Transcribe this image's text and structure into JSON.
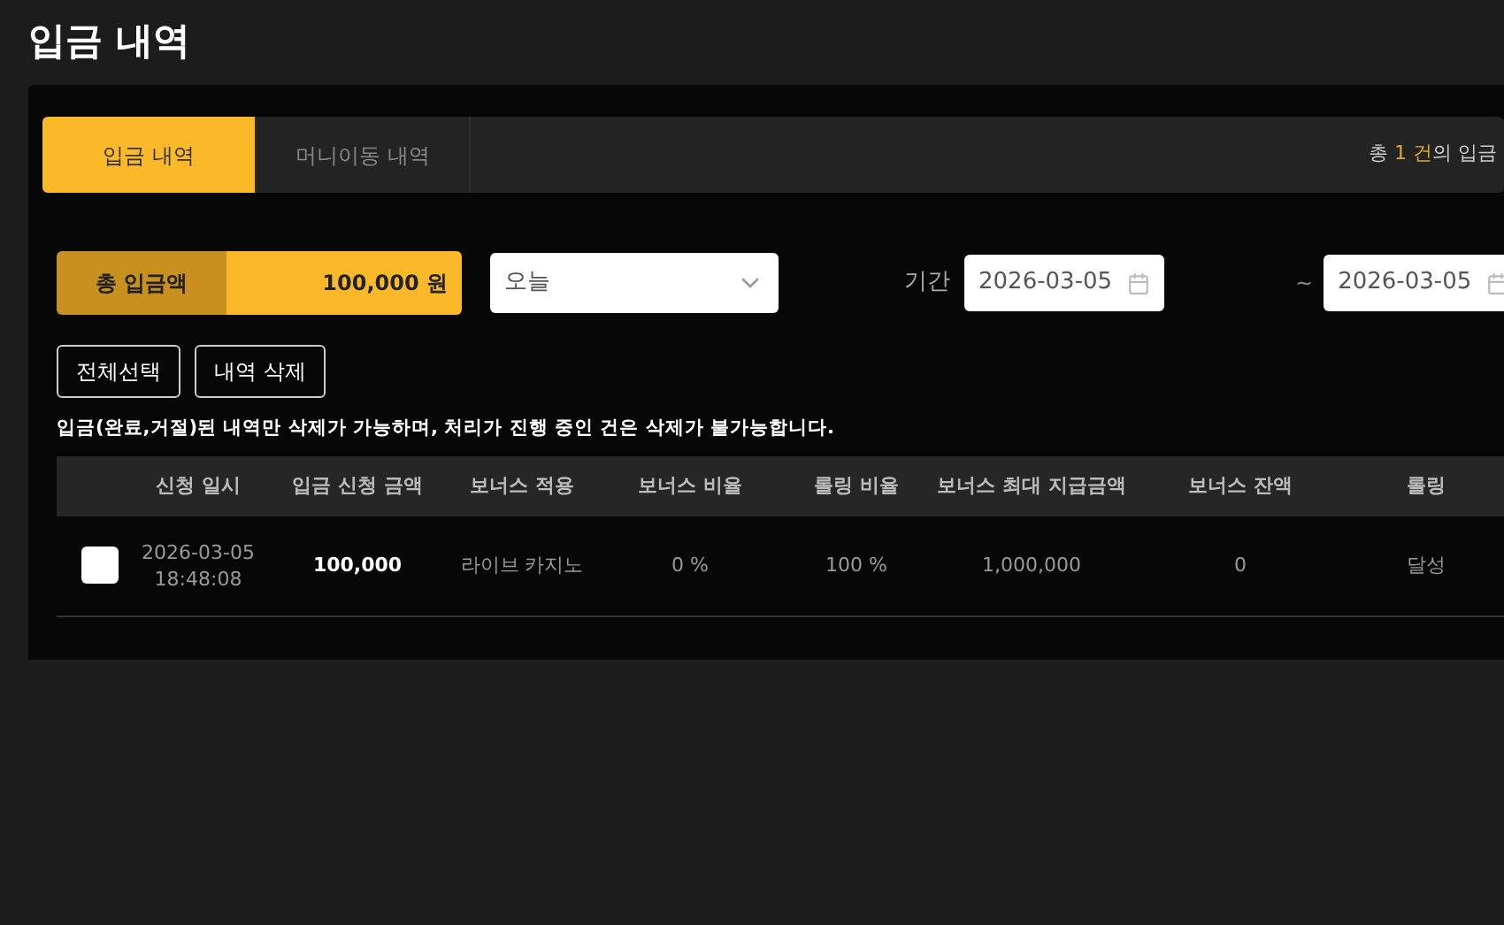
{
  "title": "입금 내역",
  "tabs": [
    {
      "label": "입금 내역",
      "selected": true
    },
    {
      "label": "머니이동 내역",
      "selected": false
    }
  ],
  "summary": {
    "prefix": "총",
    "count": "1 건",
    "suffix": "의 입금"
  },
  "total": {
    "label": "총 입금액",
    "value": "100,000 원"
  },
  "period_select": {
    "value": "오늘"
  },
  "period_label": "기간",
  "date_from": {
    "value": "2026-03-05"
  },
  "range_separator": "~",
  "date_to": {
    "value": "2026-03-05"
  },
  "buttons": [
    "전체선택",
    "내역 삭제"
  ],
  "notice": "입금(완료,거절)된 내역만 삭제가 가능하며, 처리가 진행 중인 건은 삭제가 불가능합니다.",
  "table": {
    "columns": [
      "신청 일시",
      "입금 신청 금액",
      "보너스 적용",
      "보너스 비율",
      "롤링 비율",
      "보너스 최대 지급금액",
      "보너스 잔액",
      "롤링"
    ],
    "rows": [
      {
        "checked": false,
        "cells": [
          "2026-03-05\n18:48:08",
          "100,000",
          "라이브 카지노",
          "0 %",
          "100 %",
          "1,000,000",
          "0",
          "달성"
        ]
      }
    ]
  }
}
